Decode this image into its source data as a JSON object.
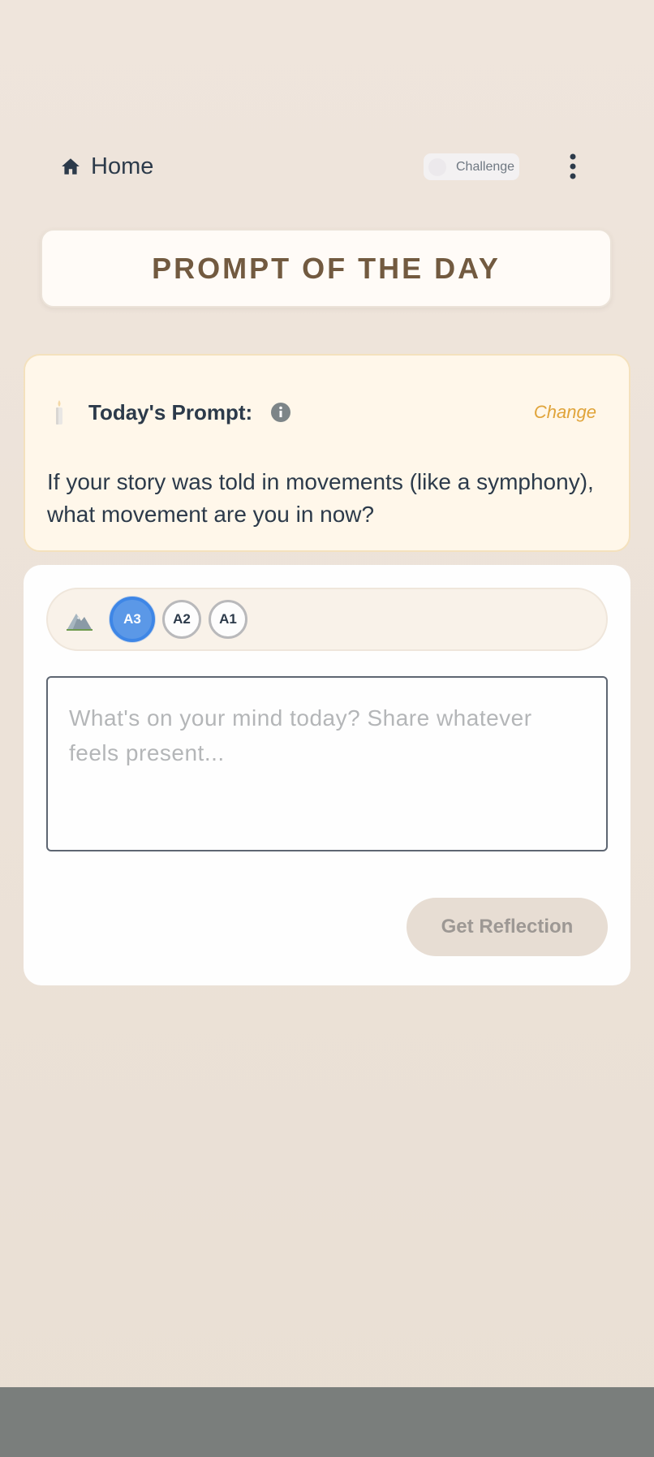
{
  "header": {
    "home_label": "Home",
    "challenge_label": "Challenge",
    "home_icon": "home-icon",
    "menu_icon": "kebab-menu-icon"
  },
  "title_card": {
    "title": "PROMPT OF THE DAY"
  },
  "prompt": {
    "icon": "candle-icon",
    "heading": "Today's Prompt:",
    "info_icon": "info-icon",
    "change_label": "Change",
    "text": "If your story was told in movements (like a symphony), what movement are you in now?"
  },
  "entry": {
    "level_icon": "mountain-icon",
    "levels": [
      {
        "label": "A3",
        "selected": true
      },
      {
        "label": "A2",
        "selected": false
      },
      {
        "label": "A1",
        "selected": false
      }
    ],
    "placeholder": "What's on your mind today? Share whatever feels present...",
    "submit_label": "Get Reflection"
  },
  "colors": {
    "background": "#ede3d9",
    "title_text": "#725a40",
    "accent_orange": "#e0a43a",
    "selected_level": "#5b98e7",
    "prompt_card_bg": "#fff7ea",
    "bottom_strip": "#7a7e7c"
  }
}
